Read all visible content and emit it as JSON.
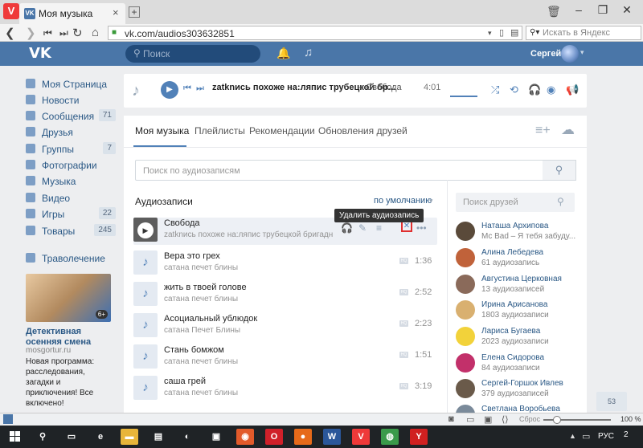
{
  "browser": {
    "vivaldi_icon": "V",
    "tab_title": "Моя музыка",
    "tab_favicon": "VK",
    "url": "vk.com/audios303632851",
    "search_placeholder": "Искать в Яндекс",
    "window_buttons": [
      "–",
      "❐",
      "✕"
    ]
  },
  "header": {
    "logo": "VK",
    "search_placeholder": "Поиск",
    "user_name": "Сергей"
  },
  "sidebar": {
    "items": [
      {
        "label": "Моя Страница",
        "count": "",
        "icon": "home-icon"
      },
      {
        "label": "Новости",
        "count": "",
        "icon": "news-icon"
      },
      {
        "label": "Сообщения",
        "count": "71",
        "icon": "messages-icon"
      },
      {
        "label": "Друзья",
        "count": "",
        "icon": "friends-icon"
      },
      {
        "label": "Группы",
        "count": "7",
        "icon": "groups-icon"
      },
      {
        "label": "Фотографии",
        "count": "",
        "icon": "camera-icon"
      },
      {
        "label": "Музыка",
        "count": "",
        "icon": "music-icon"
      },
      {
        "label": "Видео",
        "count": "",
        "icon": "video-icon"
      },
      {
        "label": "Игры",
        "count": "22",
        "icon": "games-icon"
      },
      {
        "label": "Товары",
        "count": "245",
        "icon": "goods-icon"
      }
    ],
    "group_link": "Траволечение",
    "ad": {
      "badge": "6+",
      "title": "Детективная осенняя смена",
      "domain": "mosgortur.ru",
      "text": "Новая программа: расследования, загадки и приключения! Все включено!"
    }
  },
  "player": {
    "artist": "zatknись похоже на:ляпис трубецкой бр...",
    "title": "– Свобода",
    "time": "4:01",
    "progress": 0.0
  },
  "music": {
    "tabs": [
      "Моя музыка",
      "Плейлисты",
      "Рекомендации",
      "Обновления друзей"
    ],
    "search_placeholder": "Поиск по аудиозаписям",
    "heading": "Аудиозаписи",
    "sort": "по умолчанию",
    "tooltip": "Удалить аудиозапись",
    "hq": "HQ",
    "tracks": [
      {
        "title": "Свобода",
        "artist": "zatknись похоже на:ляпис трубецкой бригадн",
        "duration": ""
      },
      {
        "title": "Вера это грех",
        "artist": "сатана печет блины",
        "duration": "1:36"
      },
      {
        "title": "жить в твоей голове",
        "artist": "сатана печет блины",
        "duration": "2:52"
      },
      {
        "title": "Асоциальный ублюдок",
        "artist": "сатана Печет Блины",
        "duration": "2:23"
      },
      {
        "title": "Стань бомжом",
        "artist": "сатана печет блины",
        "duration": "1:51"
      },
      {
        "title": "саша грей",
        "artist": "сатана печет блины",
        "duration": "3:19"
      }
    ]
  },
  "friends": {
    "search_placeholder": "Поиск друзей",
    "list": [
      {
        "name": "Наташа Архипова",
        "sub": "Mc Bad – Я тебя забуду...",
        "color": "#5a4a3a"
      },
      {
        "name": "Алина Лебедева",
        "sub": "61 аудиозапись",
        "color": "#c0623a"
      },
      {
        "name": "Августина Церковная",
        "sub": "13 аудиозаписей",
        "color": "#8a6a5a"
      },
      {
        "name": "Ирина Арисанова",
        "sub": "1803 аудиозаписи",
        "color": "#d9b070"
      },
      {
        "name": "Лариса Бугаева",
        "sub": "2023 аудиозаписи",
        "color": "#f2d23a"
      },
      {
        "name": "Елена Сидорова",
        "sub": "84 аудиозаписи",
        "color": "#c2306a"
      },
      {
        "name": "Сергей-Горшок Ивлев",
        "sub": "379 аудиозаписей",
        "color": "#6a5a4a"
      },
      {
        "name": "Светлана Воробьева",
        "sub": "",
        "color": "#7a8a9a"
      }
    ],
    "counter": "53"
  },
  "statusbar": {
    "reset": "Сброс",
    "zoom": "100 %"
  },
  "taskbar": {
    "apps": [
      {
        "name": "search",
        "glyph": "⚲",
        "bg": ""
      },
      {
        "name": "taskview",
        "glyph": "▭",
        "bg": ""
      },
      {
        "name": "edge",
        "glyph": "e",
        "bg": ""
      },
      {
        "name": "explorer",
        "glyph": "▬",
        "bg": "#e8b53a"
      },
      {
        "name": "store",
        "glyph": "▤",
        "bg": ""
      },
      {
        "name": "app1",
        "glyph": "◐",
        "bg": ""
      },
      {
        "name": "app2",
        "glyph": "▣",
        "bg": ""
      },
      {
        "name": "app3",
        "glyph": "◉",
        "bg": "#e25a2a"
      },
      {
        "name": "opera",
        "glyph": "O",
        "bg": "#d0202a"
      },
      {
        "name": "firefox",
        "glyph": "●",
        "bg": "#e66a1a"
      },
      {
        "name": "word",
        "glyph": "W",
        "bg": "#2b579a"
      },
      {
        "name": "vivaldi",
        "glyph": "V",
        "bg": "#ef3939"
      },
      {
        "name": "chrome",
        "glyph": "◍",
        "bg": "#3a9a4a"
      },
      {
        "name": "yandex",
        "glyph": "Y",
        "bg": "#d02020"
      }
    ],
    "lang": "РУС",
    "notifications": "2"
  }
}
